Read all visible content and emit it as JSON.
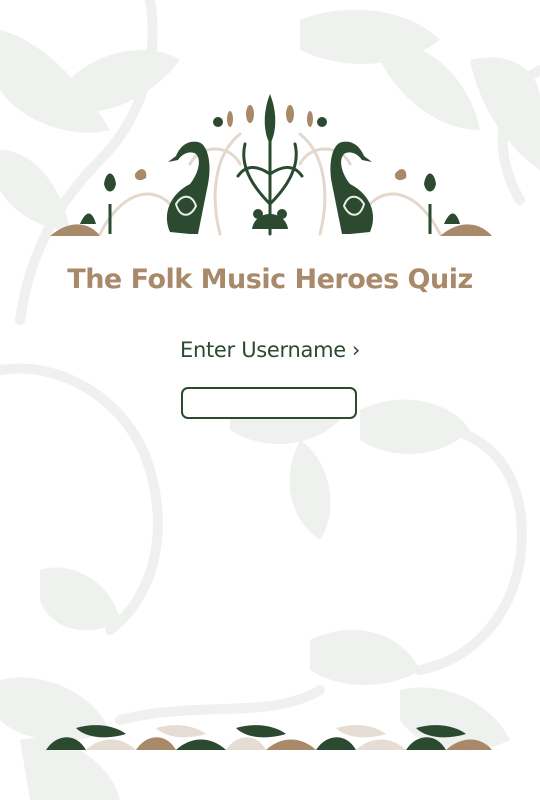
{
  "quiz": {
    "title": "The Folk Music Heroes Quiz",
    "prompt": "Enter Username",
    "prompt_arrow": "›",
    "username_value": ""
  },
  "colors": {
    "dark_green": "#2b4a30",
    "tan": "#a8896a",
    "light_sage": "#e9eee9",
    "beige": "#e5ddd3"
  },
  "icons": [
    "background-leaf-pattern",
    "heron-ornament",
    "flower-ornament",
    "folk-border-pattern"
  ]
}
